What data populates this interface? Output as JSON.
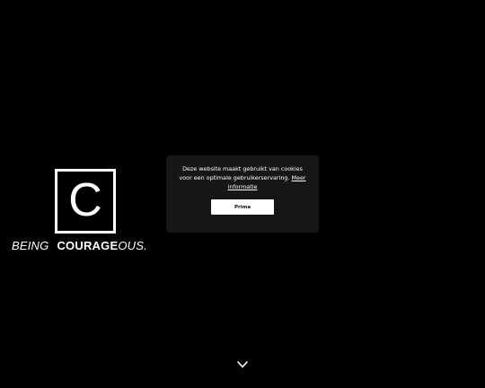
{
  "brand": {
    "logo_letter": "C",
    "tagline_being": "BEING",
    "tagline_courage": "COURAGE",
    "tagline_ous": "OUS."
  },
  "cookie_banner": {
    "message": "Deze website maakt gebruikt van cookies voor een optimale gebruikerservaring.",
    "more_info_link": "Meer informatie",
    "accept_button": "Prima"
  },
  "icons": {
    "scroll_down": "chevron-down-icon"
  },
  "colors": {
    "background": "#000000",
    "modal_background": "#161616",
    "foreground": "#ffffff"
  }
}
